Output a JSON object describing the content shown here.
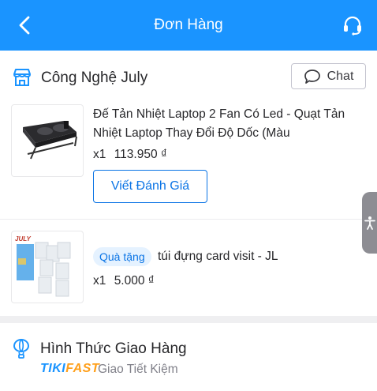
{
  "header": {
    "title": "Đơn Hàng",
    "back_icon": "chevron-left-icon",
    "support_icon": "headset-icon"
  },
  "shop": {
    "name": "Công Nghệ July",
    "icon": "store-icon",
    "chat_label": "Chat"
  },
  "product": {
    "name": "Đế Tản Nhiệt Laptop 2 Fan Có Led - Quạt Tản Nhiệt Laptop Thay Đổi Độ Dốc (Màu",
    "quantity": "x1",
    "price": "113.950 ₫",
    "review_label": "Viết Đánh Giá"
  },
  "gift": {
    "badge": "Quà tặng",
    "name": "túi đựng card visit - JL",
    "quantity": "x1",
    "price": "5.000 ₫",
    "brand_mark": "JULY"
  },
  "shipping": {
    "title": "Hình Thức Giao Hàng",
    "brand_tiki": "TIKI",
    "brand_fast": "FAST",
    "method": "Giao Tiết Kiệm",
    "icon": "balloon-icon"
  },
  "colors": {
    "primary": "#1a94ff",
    "link": "#0b74e5",
    "badge_bg": "#e5f2ff",
    "fast": "#ff9f1a"
  }
}
